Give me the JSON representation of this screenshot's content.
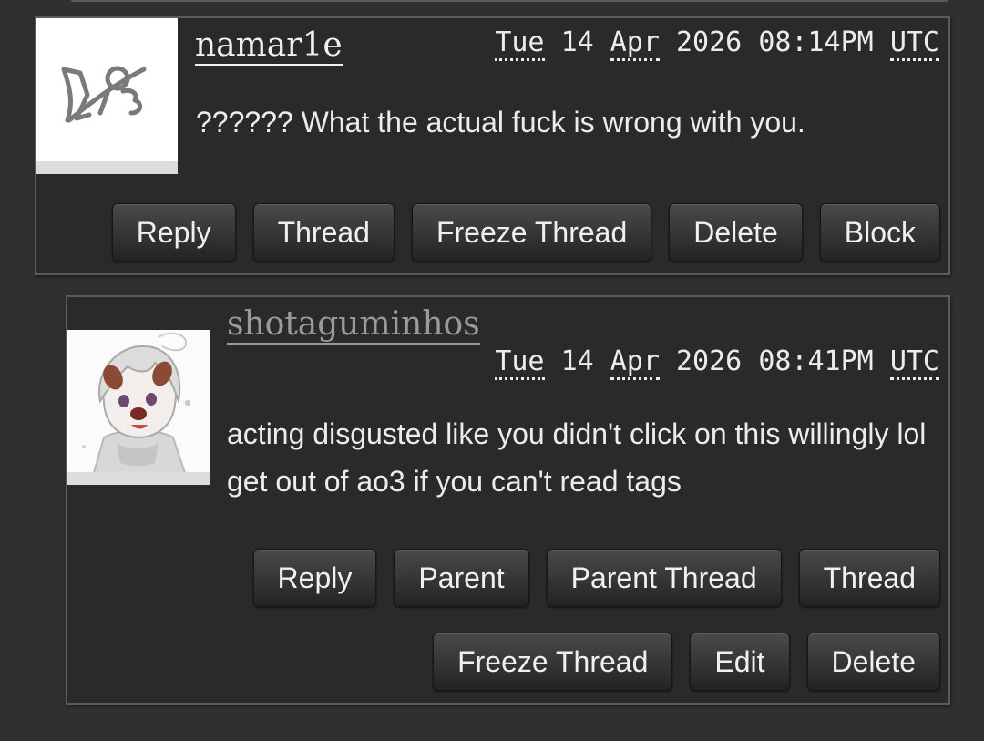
{
  "comments": [
    {
      "username": "namar1e",
      "date": {
        "weekday": "Tue",
        "day": "14",
        "month": "Apr",
        "year": "2026",
        "time": "08:14PM",
        "timezone": "UTC"
      },
      "text": "?????? What the actual fuck is wrong with you.",
      "avatar_icon": "ao3-logo-icon",
      "buttons": [
        "Reply",
        "Thread",
        "Freeze Thread",
        "Delete",
        "Block"
      ]
    },
    {
      "username": "shotaguminhos",
      "date": {
        "weekday": "Tue",
        "day": "14",
        "month": "Apr",
        "year": "2026",
        "time": "08:41PM",
        "timezone": "UTC"
      },
      "text": "acting disgusted like you didn't click on this willingly lol get out of ao3 if you can't read tags",
      "avatar_icon": "anime-character-avatar",
      "buttons_row1": [
        "Reply",
        "Parent",
        "Parent Thread",
        "Thread"
      ],
      "buttons_row2": [
        "Freeze Thread",
        "Edit",
        "Delete"
      ]
    }
  ],
  "colors": {
    "page_background": "#303030",
    "comment_background": "#2a2a2a",
    "comment_border": "#5b5b5b",
    "text": "#ececec",
    "inactive_username": "#9a9a9a",
    "button_top": "#4a4a4a",
    "button_bottom": "#232323"
  }
}
